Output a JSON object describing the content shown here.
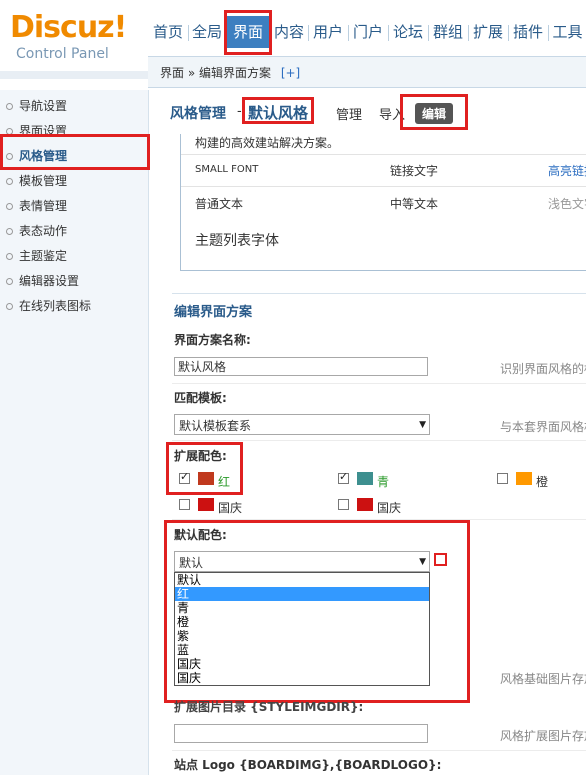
{
  "logo": {
    "title": "Discuz!",
    "subtitle": "Control Panel"
  },
  "nav": {
    "items": [
      "首页",
      "全局",
      "界面",
      "内容",
      "用户",
      "门户",
      "论坛",
      "群组",
      "扩展",
      "插件",
      "工具"
    ],
    "active": "界面"
  },
  "breadcrumb": {
    "path": "界面 » 编辑界面方案",
    "add": "[+]"
  },
  "sidebar": {
    "items": [
      "导航设置",
      "界面设置",
      "风格管理",
      "模板管理",
      "表情管理",
      "表态动作",
      "主题鉴定",
      "编辑器设置",
      "在线列表图标"
    ],
    "active": "风格管理"
  },
  "tabs": {
    "title": "风格管理",
    "separator": "-",
    "current": "默认风格",
    "manage": "管理",
    "import": "导入",
    "edit": "编辑"
  },
  "preview": {
    "desc": "构建的高效建站解决方案。",
    "small_font": "SMALL FONT",
    "link_text": "链接文字",
    "highlight_link": "高亮链接",
    "normal_text": "普通文本",
    "medium_text": "中等文本",
    "light_text": "浅色文字",
    "thread_font": "主题列表字体"
  },
  "form": {
    "section_title": "编辑界面方案",
    "name_label": "界面方案名称:",
    "name_value": "默认风格",
    "name_hint": "识别界面风格的标",
    "template_label": "匹配模板:",
    "template_value": "默认模板套系",
    "template_hint": "与本套界面风格相",
    "ext_colors_label": "扩展配色:",
    "colors": [
      {
        "name": "红",
        "checked": true,
        "color": "#c0391e",
        "text_color": "#2a9a2a"
      },
      {
        "name": "青",
        "checked": true,
        "color": "#3d8f8f",
        "text_color": "#2a9a2a"
      },
      {
        "name": "橙",
        "checked": false,
        "color": "#ff9900",
        "text_color": "#333333"
      },
      {
        "name": "国庆",
        "checked": false,
        "color": "#cc1111",
        "text_color": "#333333"
      },
      {
        "name": "国庆",
        "checked": false,
        "color": "#cc1111",
        "text_color": "#333333"
      }
    ],
    "default_color_label": "默认配色:",
    "default_color_value": "默认",
    "default_color_options": [
      "默认",
      "红",
      "青",
      "橙",
      "紫",
      "蓝",
      "国庆",
      "国庆"
    ],
    "default_color_selected": "红",
    "img_hint": "风格基础图片存放",
    "ext_img_label": "扩展图片目录 {STYLEIMGDIR}:",
    "ext_img_hint": "风格扩展图片存放",
    "logo_label": "站点 Logo {BOARDIMG},{BOARDLOGO}:"
  },
  "colors": {
    "accent": "#3d7fc0",
    "highlight": "#e02020",
    "selection": "#3399ff"
  }
}
